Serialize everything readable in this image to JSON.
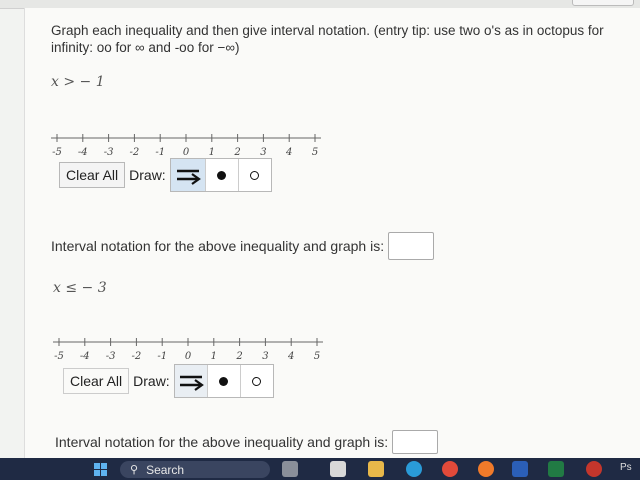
{
  "instructions": "Graph each inequality and then give interval notation. (entry tip: use two o's as in octopus for infinity: oo for ∞ and -oo for −∞)",
  "problems": [
    {
      "inequality": "x > − 1",
      "ticks": [
        "-5",
        "-4",
        "-3",
        "-2",
        "-1",
        "0",
        "1",
        "2",
        "3",
        "4",
        "5"
      ],
      "clear_label": "Clear All",
      "draw_label": "Draw:",
      "interval_prompt": "Interval notation for the above inequality and graph is:",
      "answer_value": ""
    },
    {
      "inequality": "x ≤ − 3",
      "ticks": [
        "-5",
        "-4",
        "-3",
        "-2",
        "-1",
        "0",
        "1",
        "2",
        "3",
        "4",
        "5"
      ],
      "clear_label": "Clear All",
      "draw_label": "Draw:",
      "interval_prompt": "Interval notation for the above inequality and graph is:",
      "answer_value": ""
    }
  ],
  "draw_tools": [
    {
      "icon": "ray-arrow-icon"
    },
    {
      "icon": "closed-dot-icon"
    },
    {
      "icon": "open-dot-icon"
    }
  ],
  "taskbar": {
    "search_label": "Search",
    "tray_text": "Ps"
  },
  "colors": {
    "active_tool": "#d5e4f2",
    "taskbar": "#1f2a44"
  }
}
